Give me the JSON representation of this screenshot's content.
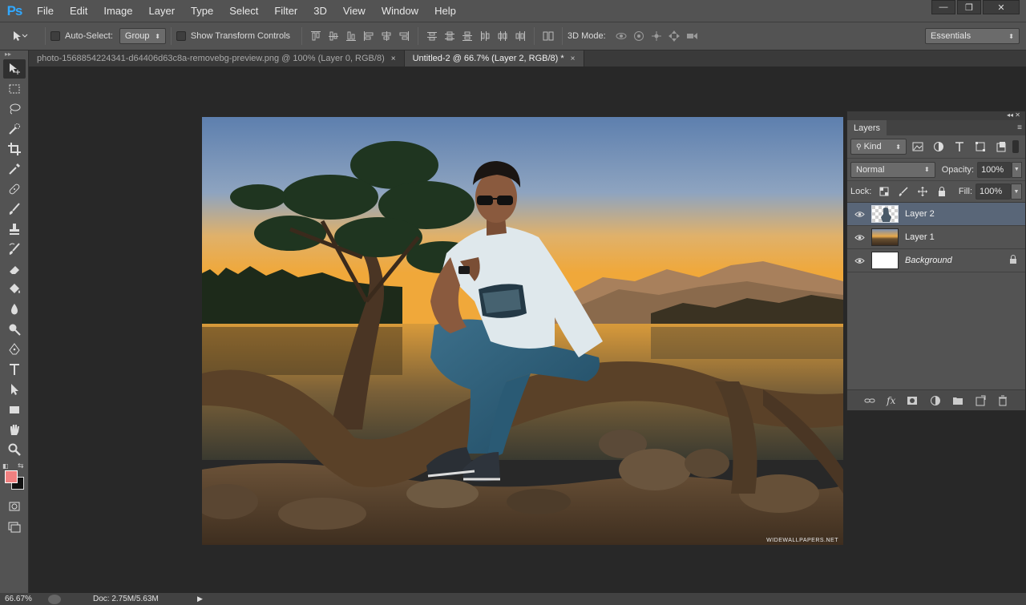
{
  "app": {
    "logo": "Ps"
  },
  "menubar": {
    "items": [
      "File",
      "Edit",
      "Image",
      "Layer",
      "Type",
      "Select",
      "Filter",
      "3D",
      "View",
      "Window",
      "Help"
    ]
  },
  "window_controls": {
    "minimize": "—",
    "restore": "❐",
    "close": "✕"
  },
  "options": {
    "auto_select_label": "Auto-Select:",
    "auto_select_value": "Group",
    "show_transform_label": "Show Transform Controls",
    "mode_3d_label": "3D Mode:",
    "workspace_value": "Essentials"
  },
  "tabs": [
    {
      "label": "photo-1568854224341-d64406d63c8a-removebg-preview.png @ 100% (Layer 0, RGB/8)",
      "close": "×"
    },
    {
      "label": "Untitled-2 @ 66.7% (Layer 2, RGB/8) *",
      "close": "×"
    }
  ],
  "colors": {
    "foreground": "#f08080",
    "background": "#111111",
    "selected_layer": "#596678"
  },
  "layers_panel": {
    "tab_label": "Layers",
    "filter_kind": "Kind",
    "blend_mode": "Normal",
    "opacity_label": "Opacity:",
    "opacity_value": "100%",
    "lock_label": "Lock:",
    "fill_label": "Fill:",
    "fill_value": "100%",
    "layers": [
      {
        "name": "Layer 2",
        "selected": true
      },
      {
        "name": "Layer 1",
        "selected": false
      },
      {
        "name": "Background",
        "selected": false,
        "locked": true
      }
    ]
  },
  "canvas": {
    "watermark": "WIDEWALLPAPERS.NET"
  },
  "status": {
    "zoom": "66.67%",
    "doc": "Doc: 2.75M/5.63M"
  }
}
